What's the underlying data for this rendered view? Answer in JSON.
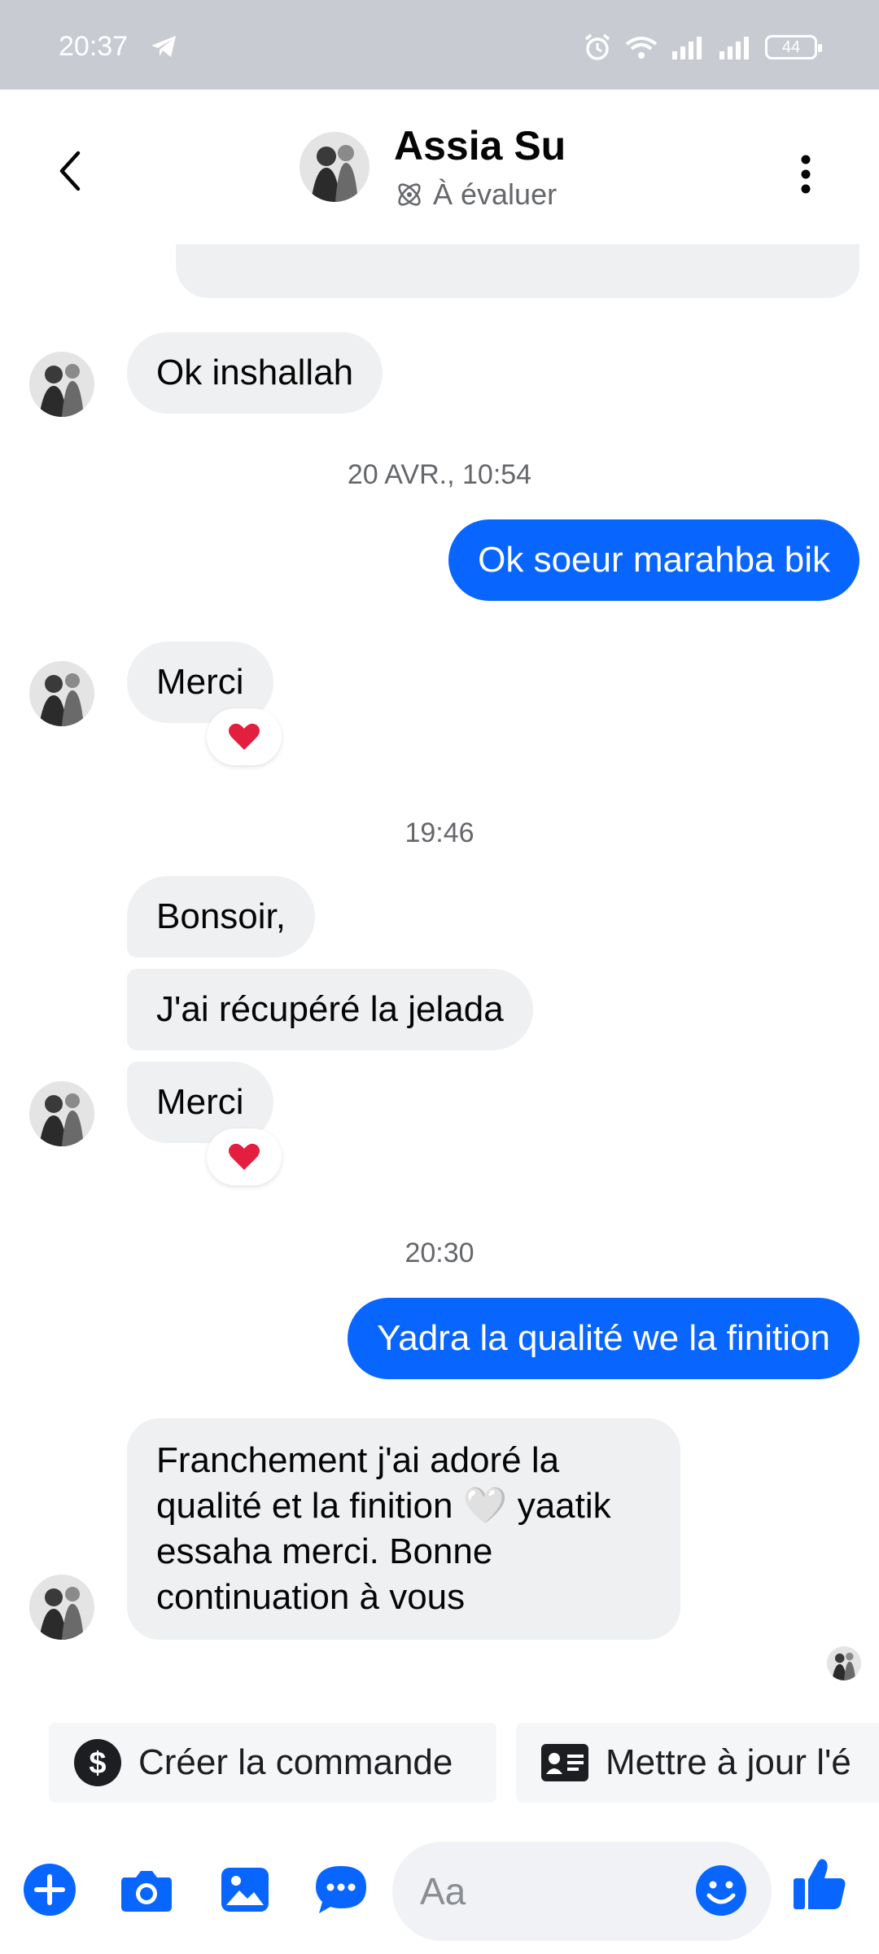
{
  "status_bar": {
    "time": "20:37",
    "battery": "44"
  },
  "header": {
    "title": "Assia Su",
    "subtitle": "À évaluer",
    "back_icon": "chevron-left-icon",
    "menu_icon": "kebab-menu-icon"
  },
  "messages": [
    {
      "side": "in",
      "text": "Ok inshallah"
    },
    {
      "timestamp": "20 AVR., 10:54"
    },
    {
      "side": "out",
      "text": "Ok soeur marahba bik"
    },
    {
      "side": "in",
      "text": "Merci",
      "reaction": "❤️"
    },
    {
      "timestamp": "19:46"
    },
    {
      "side": "in",
      "text": "Bonsoir,"
    },
    {
      "side": "in",
      "text": "J'ai récupéré la jelada"
    },
    {
      "side": "in",
      "text": "Merci",
      "reaction": "❤️"
    },
    {
      "timestamp": "20:30"
    },
    {
      "side": "out",
      "text": "Yadra la qualité we la finition"
    },
    {
      "side": "in",
      "text": "Franchement j'ai adoré la qualité et la finition 🤍 yaatik essaha merci. Bonne continuation à vous"
    }
  ],
  "quick_actions": [
    {
      "label": "Créer la commande",
      "icon": "dollar-icon"
    },
    {
      "label": "Mettre à jour l'é",
      "icon": "contact-card-icon"
    }
  ],
  "composer": {
    "placeholder": "Aa",
    "icons": [
      "plus-icon",
      "camera-icon",
      "image-icon",
      "chat-bubble-icon",
      "emoji-icon",
      "like-icon"
    ]
  },
  "colors": {
    "accent": "#0866ff",
    "incoming_bubble": "#eff0f2",
    "reaction": "#e41e3f"
  }
}
